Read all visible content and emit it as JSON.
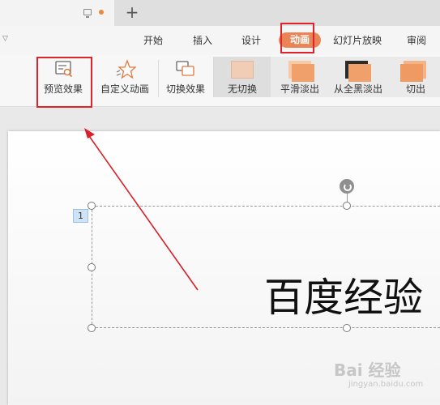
{
  "menu": {
    "tabs": [
      "开始",
      "插入",
      "设计",
      "动画",
      "幻灯片放映",
      "审阅"
    ],
    "active_tab": "动画"
  },
  "ribbon": {
    "preview_label": "预览效果",
    "custom_anim_label": "自定义动画",
    "switch_effect_label": "切换效果",
    "transitions": [
      "无切换",
      "平滑淡出",
      "从全黑淡出",
      "切出"
    ]
  },
  "slide": {
    "anim_number": "1",
    "text": "百度经验"
  },
  "watermark": {
    "text": "Bai 经验",
    "sub": "jingyan.baidu.com"
  },
  "colors": {
    "accent": "#e98456",
    "highlight_box": "#e0232b",
    "arrow": "#d9202a"
  }
}
